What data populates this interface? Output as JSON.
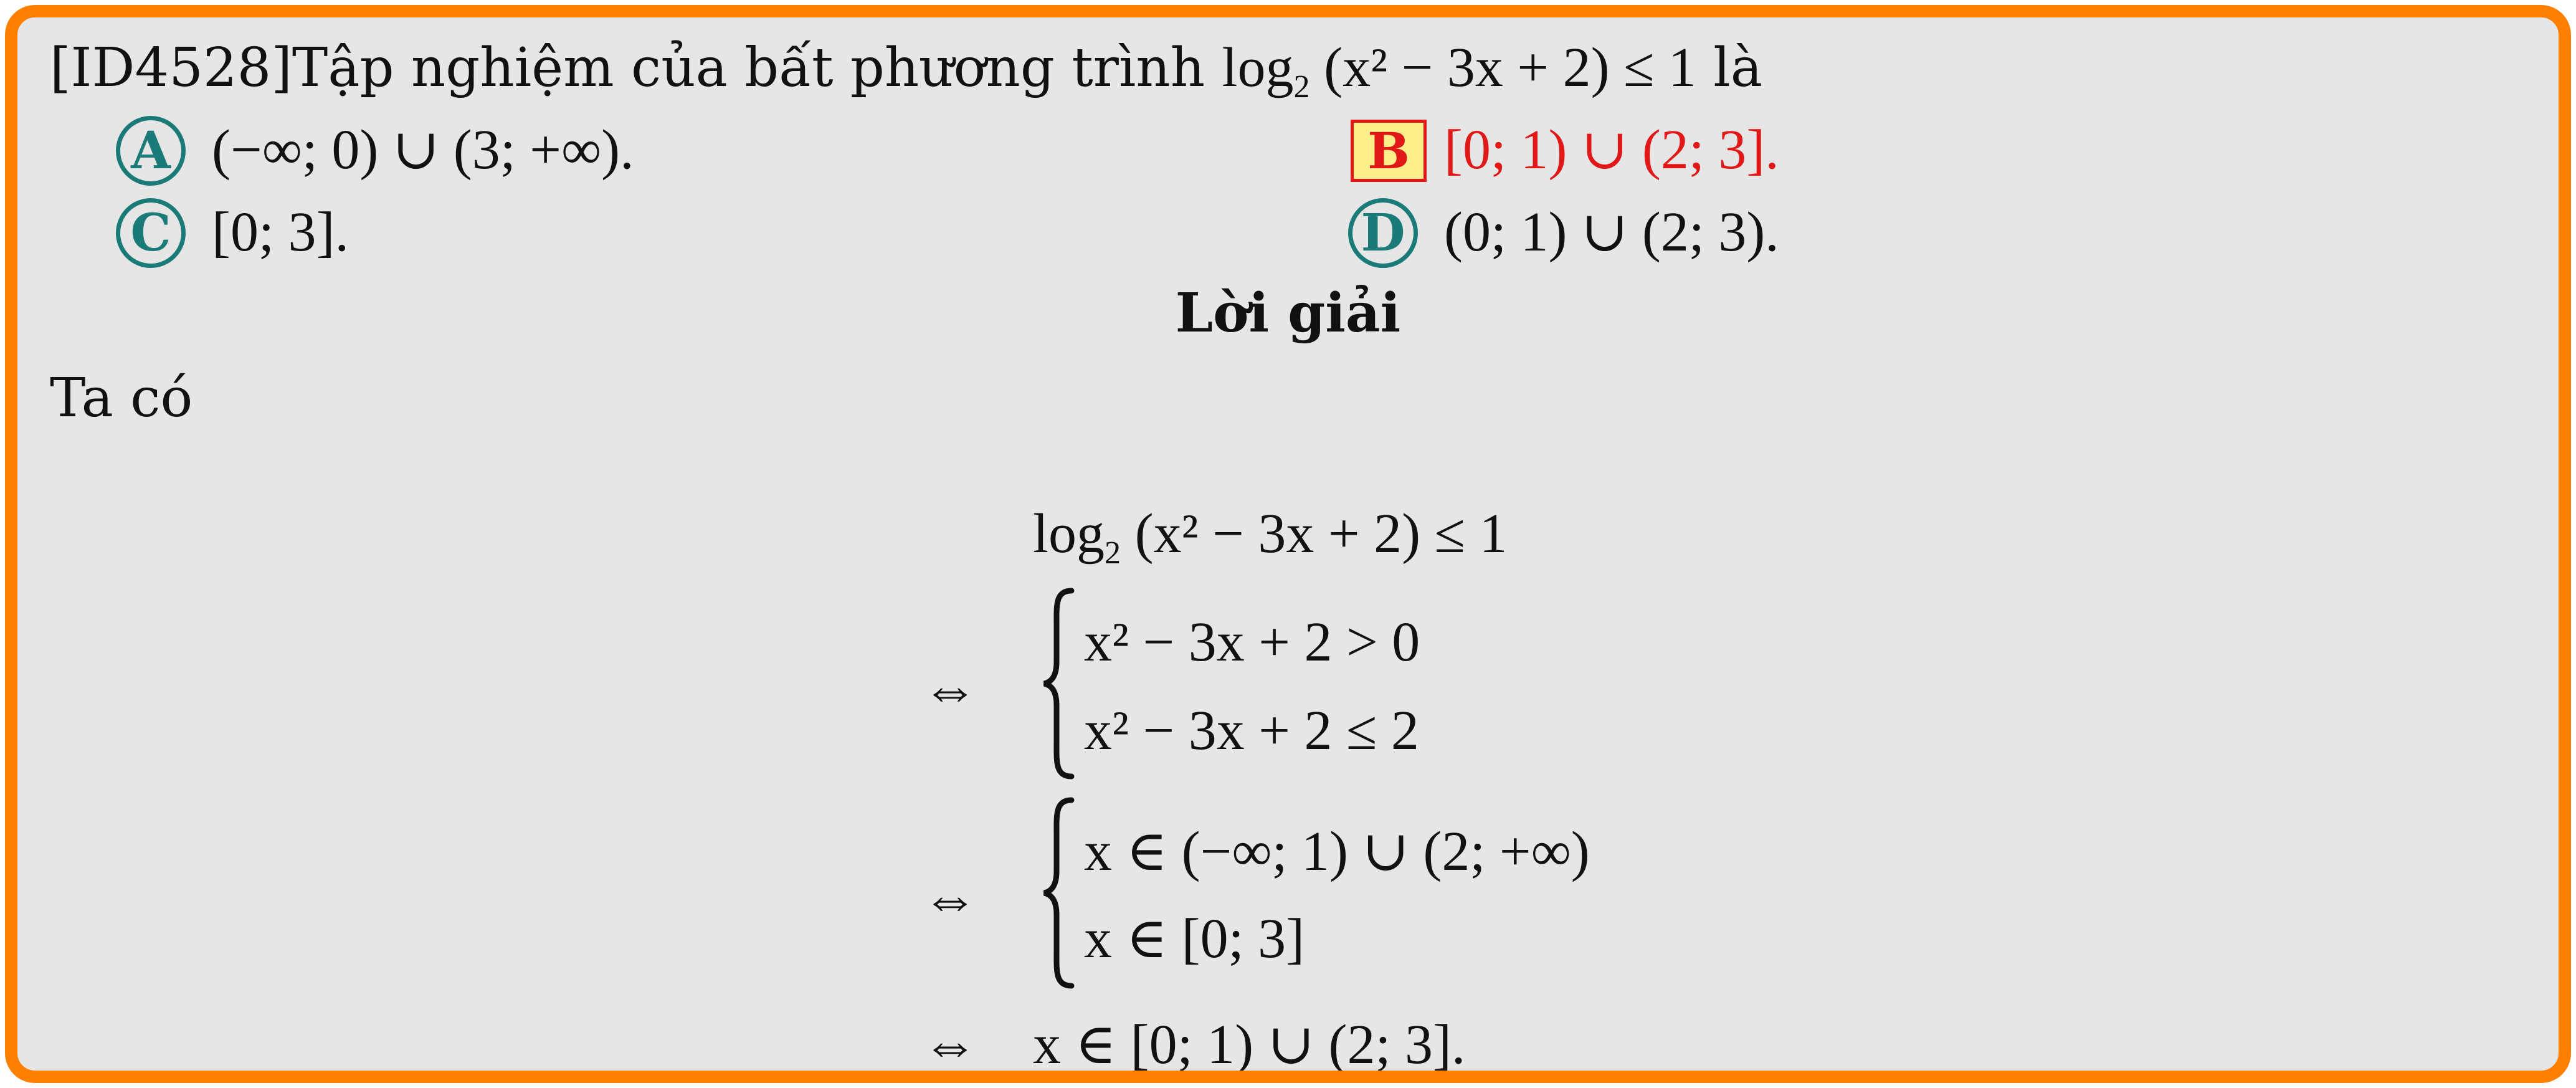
{
  "question": {
    "prefix": "[ID4528]Tập nghiệm của bất phương trình ",
    "log": "log",
    "log_base": "2",
    "expr": "(x² − 3x + 2) ≤ 1",
    "suffix": " là"
  },
  "options": [
    {
      "label": "A",
      "text": "(−∞; 0) ∪ (3; +∞)."
    },
    {
      "label": "B",
      "text": "[0; 1) ∪ (2; 3].",
      "correct": true
    },
    {
      "label": "C",
      "text": "[0; 3]."
    },
    {
      "label": "D",
      "text": "(0; 1) ∪ (2; 3)."
    }
  ],
  "solution": {
    "heading": "Lời giải",
    "intro": "Ta có",
    "equiv": "⇔",
    "line1": "(x² − 3x + 2) ≤ 1",
    "sys1": [
      "x² − 3x + 2 > 0",
      "x² − 3x + 2 ≤ 2"
    ],
    "sys2": [
      "x ∈ (−∞; 1) ∪ (2; +∞)",
      "x ∈ [0; 3]"
    ],
    "final": "x ∈ [0; 1) ∪ (2; 3]."
  },
  "colors": {
    "frame_border": "#ff8000",
    "background": "#e6e6e6",
    "option_teal": "#1a7a78",
    "correct_red": "#e01818",
    "correct_fill": "#ffef8a"
  }
}
